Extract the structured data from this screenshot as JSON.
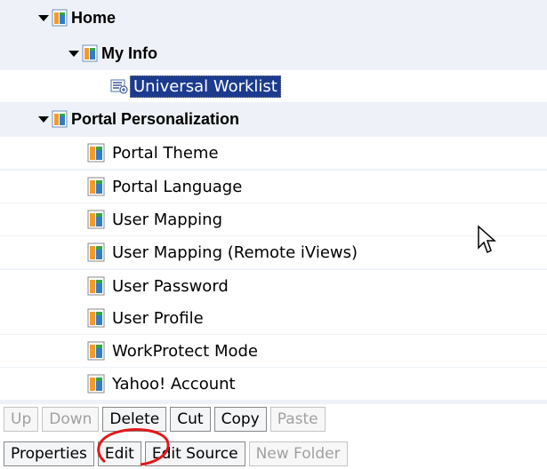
{
  "tree": {
    "home": "Home",
    "my_info": "My Info",
    "universal_worklist": "Universal Worklist",
    "portal_personalization": "Portal Personalization",
    "children": [
      "Portal Theme",
      "Portal Language",
      "User Mapping",
      "User Mapping (Remote iViews)",
      "User Password",
      "User Profile",
      "WorkProtect Mode",
      "Yahoo! Account"
    ]
  },
  "toolbar": {
    "row1": [
      "Up",
      "Down",
      "Delete",
      "Cut",
      "Copy",
      "Paste"
    ],
    "row2": [
      "Properties",
      "Edit",
      "Edit Source",
      "New Folder"
    ]
  },
  "colors": {
    "selection": "#1c3b8e",
    "highlight_circle": "#e0191b"
  },
  "icons": [
    "expand-arrow-icon",
    "folder-icon",
    "iview-icon",
    "worklist-icon",
    "mouse-cursor-icon"
  ]
}
